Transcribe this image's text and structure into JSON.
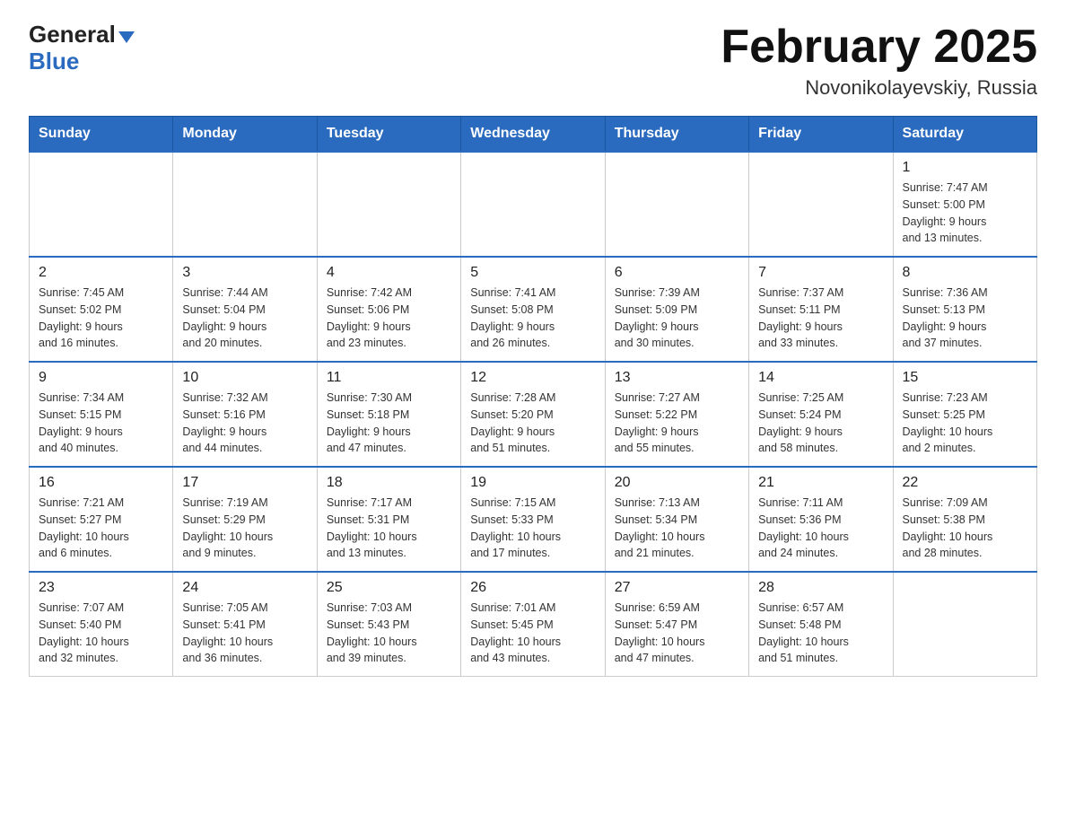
{
  "logo": {
    "general": "General",
    "blue": "Blue",
    "arrow": "▼"
  },
  "title": "February 2025",
  "subtitle": "Novonikolayevskiy, Russia",
  "days_of_week": [
    "Sunday",
    "Monday",
    "Tuesday",
    "Wednesday",
    "Thursday",
    "Friday",
    "Saturday"
  ],
  "weeks": [
    [
      {
        "day": "",
        "info": ""
      },
      {
        "day": "",
        "info": ""
      },
      {
        "day": "",
        "info": ""
      },
      {
        "day": "",
        "info": ""
      },
      {
        "day": "",
        "info": ""
      },
      {
        "day": "",
        "info": ""
      },
      {
        "day": "1",
        "info": "Sunrise: 7:47 AM\nSunset: 5:00 PM\nDaylight: 9 hours\nand 13 minutes."
      }
    ],
    [
      {
        "day": "2",
        "info": "Sunrise: 7:45 AM\nSunset: 5:02 PM\nDaylight: 9 hours\nand 16 minutes."
      },
      {
        "day": "3",
        "info": "Sunrise: 7:44 AM\nSunset: 5:04 PM\nDaylight: 9 hours\nand 20 minutes."
      },
      {
        "day": "4",
        "info": "Sunrise: 7:42 AM\nSunset: 5:06 PM\nDaylight: 9 hours\nand 23 minutes."
      },
      {
        "day": "5",
        "info": "Sunrise: 7:41 AM\nSunset: 5:08 PM\nDaylight: 9 hours\nand 26 minutes."
      },
      {
        "day": "6",
        "info": "Sunrise: 7:39 AM\nSunset: 5:09 PM\nDaylight: 9 hours\nand 30 minutes."
      },
      {
        "day": "7",
        "info": "Sunrise: 7:37 AM\nSunset: 5:11 PM\nDaylight: 9 hours\nand 33 minutes."
      },
      {
        "day": "8",
        "info": "Sunrise: 7:36 AM\nSunset: 5:13 PM\nDaylight: 9 hours\nand 37 minutes."
      }
    ],
    [
      {
        "day": "9",
        "info": "Sunrise: 7:34 AM\nSunset: 5:15 PM\nDaylight: 9 hours\nand 40 minutes."
      },
      {
        "day": "10",
        "info": "Sunrise: 7:32 AM\nSunset: 5:16 PM\nDaylight: 9 hours\nand 44 minutes."
      },
      {
        "day": "11",
        "info": "Sunrise: 7:30 AM\nSunset: 5:18 PM\nDaylight: 9 hours\nand 47 minutes."
      },
      {
        "day": "12",
        "info": "Sunrise: 7:28 AM\nSunset: 5:20 PM\nDaylight: 9 hours\nand 51 minutes."
      },
      {
        "day": "13",
        "info": "Sunrise: 7:27 AM\nSunset: 5:22 PM\nDaylight: 9 hours\nand 55 minutes."
      },
      {
        "day": "14",
        "info": "Sunrise: 7:25 AM\nSunset: 5:24 PM\nDaylight: 9 hours\nand 58 minutes."
      },
      {
        "day": "15",
        "info": "Sunrise: 7:23 AM\nSunset: 5:25 PM\nDaylight: 10 hours\nand 2 minutes."
      }
    ],
    [
      {
        "day": "16",
        "info": "Sunrise: 7:21 AM\nSunset: 5:27 PM\nDaylight: 10 hours\nand 6 minutes."
      },
      {
        "day": "17",
        "info": "Sunrise: 7:19 AM\nSunset: 5:29 PM\nDaylight: 10 hours\nand 9 minutes."
      },
      {
        "day": "18",
        "info": "Sunrise: 7:17 AM\nSunset: 5:31 PM\nDaylight: 10 hours\nand 13 minutes."
      },
      {
        "day": "19",
        "info": "Sunrise: 7:15 AM\nSunset: 5:33 PM\nDaylight: 10 hours\nand 17 minutes."
      },
      {
        "day": "20",
        "info": "Sunrise: 7:13 AM\nSunset: 5:34 PM\nDaylight: 10 hours\nand 21 minutes."
      },
      {
        "day": "21",
        "info": "Sunrise: 7:11 AM\nSunset: 5:36 PM\nDaylight: 10 hours\nand 24 minutes."
      },
      {
        "day": "22",
        "info": "Sunrise: 7:09 AM\nSunset: 5:38 PM\nDaylight: 10 hours\nand 28 minutes."
      }
    ],
    [
      {
        "day": "23",
        "info": "Sunrise: 7:07 AM\nSunset: 5:40 PM\nDaylight: 10 hours\nand 32 minutes."
      },
      {
        "day": "24",
        "info": "Sunrise: 7:05 AM\nSunset: 5:41 PM\nDaylight: 10 hours\nand 36 minutes."
      },
      {
        "day": "25",
        "info": "Sunrise: 7:03 AM\nSunset: 5:43 PM\nDaylight: 10 hours\nand 39 minutes."
      },
      {
        "day": "26",
        "info": "Sunrise: 7:01 AM\nSunset: 5:45 PM\nDaylight: 10 hours\nand 43 minutes."
      },
      {
        "day": "27",
        "info": "Sunrise: 6:59 AM\nSunset: 5:47 PM\nDaylight: 10 hours\nand 47 minutes."
      },
      {
        "day": "28",
        "info": "Sunrise: 6:57 AM\nSunset: 5:48 PM\nDaylight: 10 hours\nand 51 minutes."
      },
      {
        "day": "",
        "info": ""
      }
    ]
  ]
}
